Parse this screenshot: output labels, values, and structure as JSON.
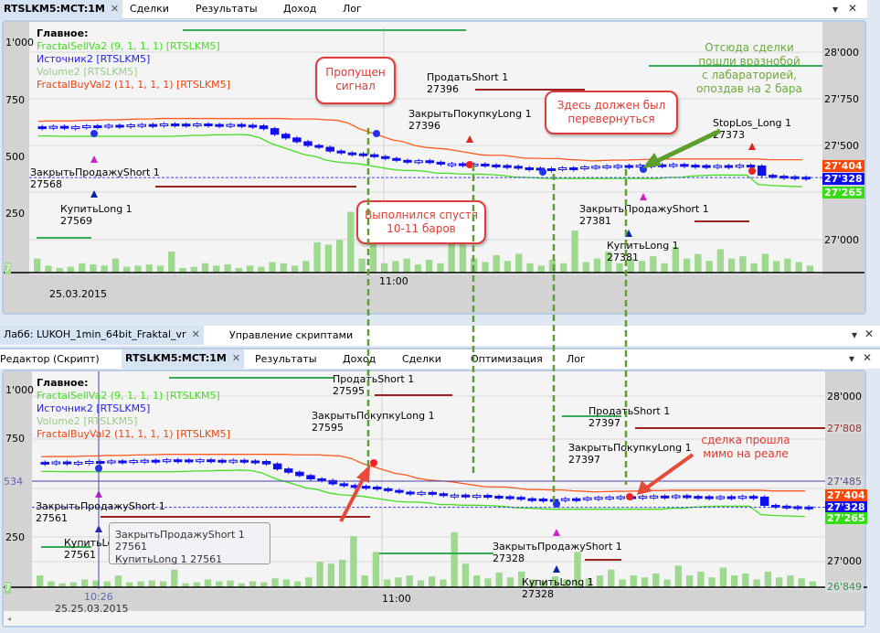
{
  "top": {
    "tabs": [
      "RTSLKM5:MCT:1M",
      "Сделки",
      "Результаты",
      "Доход",
      "Лог"
    ],
    "legend": {
      "title": "Главное:",
      "items": [
        {
          "text": "FractalSellVa2 (9, 1, 1, 1) [RTSLKM5]",
          "color": "#44dd22"
        },
        {
          "text": "Источник2 [RTSLKM5]",
          "color": "#2222ee"
        },
        {
          "text": "Volume2 [RTSLKM5]",
          "color": "#99cc88"
        },
        {
          "text": "FractalBuyVal2 (11, 1, 1, 1) [RTSLKM5]",
          "color": "#ee4411"
        }
      ]
    },
    "left_axis": [
      "1'000",
      "750",
      "500",
      "250",
      "7"
    ],
    "right_axis": [
      "28'000",
      "27'750",
      "27'500",
      "27'000"
    ],
    "price_tags": [
      {
        "v": "27'404",
        "c": "#ff4500"
      },
      {
        "v": "27'328",
        "c": "#1010ee"
      },
      {
        "v": "27'265",
        "c": "#33dd11"
      }
    ],
    "time": "11:00",
    "date": "25.03.2015",
    "trades": [
      {
        "a": "ПродатьShort 1",
        "b": "27396"
      },
      {
        "a": "ЗакрытьПокупкуLong 1",
        "b": "27396"
      },
      {
        "a": "ЗакрытьПродажуShort 1",
        "b": "27568"
      },
      {
        "a": "КупитьLong 1",
        "b": "27569"
      },
      {
        "a": "StopLos_Long 1",
        "b": "27373"
      },
      {
        "a": "ЗакрытьПродажуShort 1",
        "b": "27381"
      },
      {
        "a": "КупитьLong 1",
        "b": "27381"
      }
    ],
    "callouts": [
      "Пропущен сигнал",
      "Выполнился спустя 10-11 баров",
      "Здесь должен был перевернуться"
    ],
    "note": "Отсюда сделки пошли вразнобой с лабараторией, опоздав на 2 бара",
    "volumes": [
      60,
      30,
      20,
      25,
      40,
      35,
      30,
      60,
      25,
      30,
      35,
      30,
      90,
      20,
      25,
      40,
      30,
      35,
      20,
      30,
      25,
      45,
      40,
      30,
      50,
      130,
      120,
      140,
      260,
      60,
      180,
      40,
      50,
      60,
      35,
      55,
      40,
      280,
      120,
      60,
      45,
      75,
      50,
      80,
      40,
      30,
      55,
      40,
      180,
      45,
      60,
      90,
      40,
      60,
      50,
      70,
      40,
      110,
      60,
      80,
      50,
      100,
      60,
      70,
      40,
      80,
      50,
      60,
      45,
      30
    ],
    "prices": [
      27600,
      27602,
      27598,
      27600,
      27605,
      27603,
      27608,
      27606,
      27610,
      27612,
      27610,
      27615,
      27614,
      27612,
      27615,
      27612,
      27610,
      27612,
      27608,
      27605,
      27590,
      27560,
      27540,
      27520,
      27500,
      27490,
      27470,
      27460,
      27455,
      27450,
      27440,
      27430,
      27420,
      27415,
      27418,
      27410,
      27400,
      27402,
      27396,
      27400,
      27395,
      27392,
      27388,
      27380,
      27378,
      27375,
      27372,
      27380,
      27378,
      27385,
      27388,
      27390,
      27392,
      27390,
      27394,
      27396,
      27394,
      27398,
      27394,
      27392,
      27390,
      27392,
      27390,
      27394,
      27390,
      27340,
      27335,
      27332,
      27330,
      27328
    ]
  },
  "bottom": {
    "window_tabs": [
      "Лаб6: LUKOH_1min_64bit_Fraktal_vr",
      "Управление скриптами"
    ],
    "tabs": [
      "Редактор (Скрипт)",
      "RTSLKM5:MCT:1M",
      "Результаты",
      "Доход",
      "Сделки",
      "Оптимизация",
      "Лог"
    ],
    "legend": {
      "title": "Главное:",
      "items": [
        {
          "text": "FractalSellVa2 (9, 1, 1, 1) [RTSLKM5]",
          "color": "#44dd22"
        },
        {
          "text": "Источник2 [RTSLKM5]",
          "color": "#2222ee"
        },
        {
          "text": "Volume2 [RTSLKM5]",
          "color": "#99cc88"
        },
        {
          "text": "FractalBuyVal2 (11, 1, 1, 1) [RTSLKM5]",
          "color": "#ee4411"
        }
      ]
    },
    "left_axis": [
      "1'000",
      "750",
      "534",
      "250",
      "7"
    ],
    "right_axis": [
      "28'000",
      "27'000"
    ],
    "price_tags": [
      {
        "v": "27'808",
        "c": "#d9d9d9",
        "t": "#993333"
      },
      {
        "v": "27'485",
        "c": "#d9d9d9",
        "t": "#555588"
      },
      {
        "v": "27'404",
        "c": "#ff4500",
        "t": "#fff"
      },
      {
        "v": "27'328",
        "c": "#1010ee",
        "t": "#fff"
      },
      {
        "v": "27'265",
        "c": "#33dd11",
        "t": "#fff"
      },
      {
        "v": "26'849",
        "c": "#d9d9d9",
        "t": "#339955"
      }
    ],
    "time_cursor": "10:26",
    "time": "11:00",
    "date": "25.25.03.2015",
    "trades": [
      {
        "a": "ПродатьShort 1",
        "b": "27595"
      },
      {
        "a": "ЗакрытьПокупкуLong 1",
        "b": "27595"
      },
      {
        "a": "ЗакрытьПродажуShort 1",
        "b": "27561"
      },
      {
        "a": "КупитьLong 1",
        "b": "27561"
      },
      {
        "a": "ПродатьShort 1",
        "b": "27397"
      },
      {
        "a": "ЗакрытьПокупкуLong 1",
        "b": "27397"
      },
      {
        "a": "ЗакрытьПродажуShort 1",
        "b": "27328"
      },
      {
        "a": "КупитьLong 1",
        "b": "27328"
      }
    ],
    "tooltip": [
      "ЗакрытьПродажуShort 1 27561",
      "КупитьLong 1 27561"
    ],
    "callout": "сделка прошла мимо на реале"
  }
}
